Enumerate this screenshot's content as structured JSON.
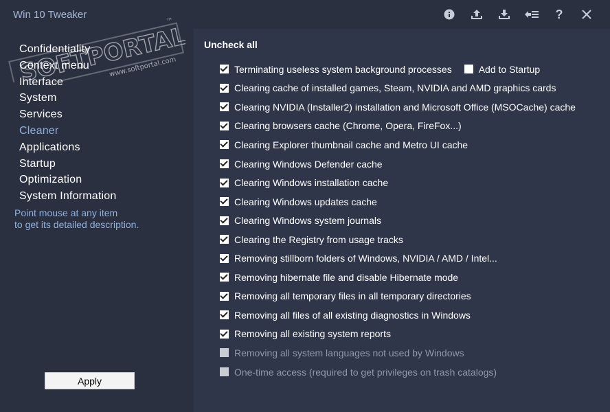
{
  "window": {
    "title": "Win 10 Tweaker"
  },
  "titlebar_icons": [
    {
      "name": "info-icon"
    },
    {
      "name": "export-icon"
    },
    {
      "name": "import-icon"
    },
    {
      "name": "menu-back-icon"
    },
    {
      "name": "help-icon",
      "glyph": "?"
    },
    {
      "name": "close-icon"
    }
  ],
  "watermark": {
    "text": "SOFTPORTAL",
    "url": "www.softportal.com",
    "tm": "™"
  },
  "sidebar": {
    "items": [
      {
        "label": "Confidentiality"
      },
      {
        "label": "Context menu"
      },
      {
        "label": "Interface"
      },
      {
        "label": "System"
      },
      {
        "label": "Services"
      },
      {
        "label": "Cleaner",
        "active": true
      },
      {
        "label": "Applications"
      },
      {
        "label": "Startup"
      },
      {
        "label": "Optimization"
      },
      {
        "label": "System Information"
      }
    ],
    "hint_line1": "Point mouse at any item",
    "hint_line2": "to get its detailed description.",
    "apply_label": "Apply"
  },
  "main": {
    "uncheck_all_label": "Uncheck all",
    "items": [
      {
        "label": "Terminating useless system background processes",
        "checked": true,
        "extra_label": "Add to Startup",
        "extra_checked": false
      },
      {
        "label": "Clearing cache of installed games, Steam, NVIDIA and AMD graphics cards",
        "checked": true
      },
      {
        "label": "Clearing NVIDIA (Installer2) installation and Microsoft Office (MSOCache) cache",
        "checked": true
      },
      {
        "label": "Clearing browsers cache (Chrome, Opera, FireFox...)",
        "checked": true
      },
      {
        "label": "Clearing Explorer thumbnail cache and Metro UI cache",
        "checked": true
      },
      {
        "label": "Clearing Windows Defender cache",
        "checked": true
      },
      {
        "label": "Clearing Windows installation cache",
        "checked": true
      },
      {
        "label": "Clearing Windows updates cache",
        "checked": true
      },
      {
        "label": "Clearing Windows system journals",
        "checked": true
      },
      {
        "label": "Clearing the Registry from usage tracks",
        "checked": true
      },
      {
        "label": "Removing stillborn folders of Windows, NVIDIA / AMD / Intel...",
        "checked": true
      },
      {
        "label": "Removing hibernate file and disable Hibernate mode",
        "checked": true
      },
      {
        "label": "Removing all temporary files in all temporary directories",
        "checked": true
      },
      {
        "label": "Removing all files of all existing diagnostics in Windows",
        "checked": true
      },
      {
        "label": "Removing all existing system reports",
        "checked": true
      },
      {
        "label": "Removing all system languages not used by Windows",
        "checked": false,
        "disabled": true
      },
      {
        "label": "One-time access (required to get privileges on trash catalogs)",
        "checked": false,
        "disabled": true
      }
    ]
  },
  "colors": {
    "background": "#30364a",
    "sidebar": "#2b3041",
    "accent": "#8fb0dd",
    "icon": "#c6ccd8"
  }
}
